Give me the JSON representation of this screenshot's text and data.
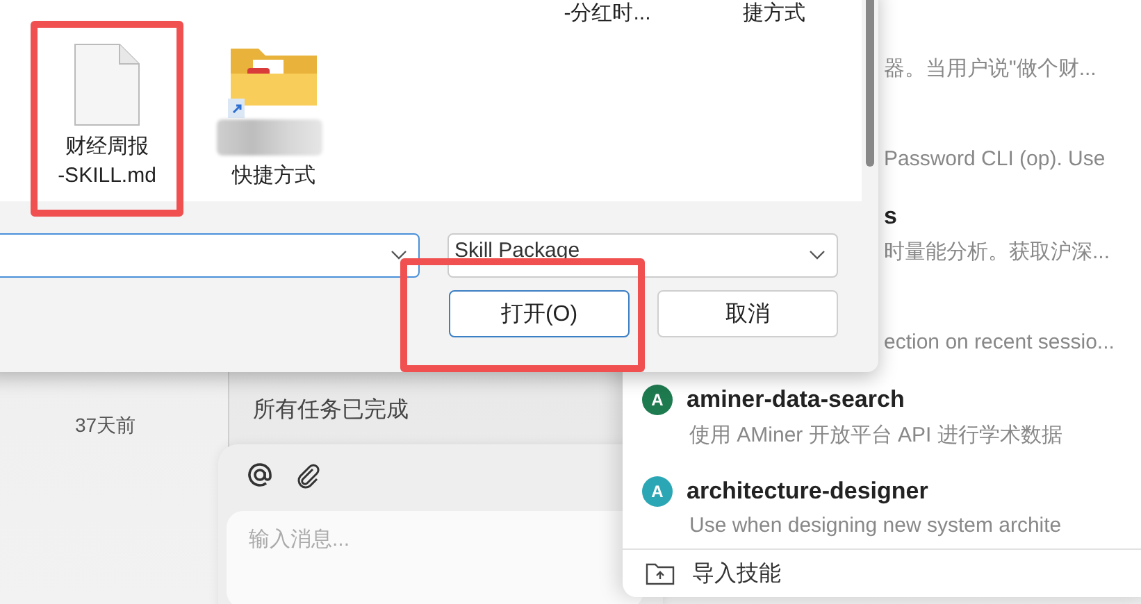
{
  "sidebar": {
    "time": "37天前"
  },
  "chat": {
    "status": "所有任务已完成",
    "input": {
      "placeholder": "输入消息..."
    }
  },
  "skill_panel": {
    "items": [
      {
        "kind": "partial",
        "description": "器。当用户说\"做个财..."
      },
      {
        "kind": "partial",
        "description": "Password CLI (op). Use"
      },
      {
        "kind": "partial",
        "name": "s",
        "description": "时量能分析。获取沪深..."
      },
      {
        "kind": "partial",
        "description": "ection on recent sessio..."
      },
      {
        "kind": "full",
        "badge": "A",
        "color": "#1e7a4f",
        "name": "aminer-data-search",
        "description": "使用 AMiner 开放平台 API 进行学术数据"
      },
      {
        "kind": "full",
        "badge": "A",
        "color": "#2aa6b4",
        "name": "architecture-designer",
        "description": "Use when designing new system archite"
      }
    ],
    "footer": "导入技能"
  },
  "file_dialog": {
    "partial_row": [
      {
        "kind": "blank"
      },
      {
        "kind": "blank"
      },
      {
        "kind": "blank"
      },
      {
        "kind": "label",
        "label": "-分红时..."
      },
      {
        "kind": "label",
        "label": "捷方式"
      }
    ],
    "files": [
      {
        "kind": "document",
        "name": "财经周报\n-SKILL.md"
      },
      {
        "kind": "shortcut-folder",
        "name": "快捷方式"
      }
    ],
    "filter": "Skill Package",
    "buttons": [
      {
        "kind": "primary",
        "label": "打开(O)"
      },
      {
        "kind": "secondary",
        "label": "取消"
      }
    ]
  }
}
